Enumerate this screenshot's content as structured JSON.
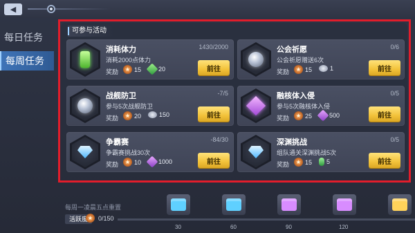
{
  "nav": {
    "tabs": [
      {
        "label": "每日任务",
        "active": false
      },
      {
        "label": "每周任务",
        "active": true
      }
    ]
  },
  "section_title": "可参与活动",
  "reward_label": "奖励",
  "goto_label": "前往",
  "cards": [
    {
      "name": "消耗体力",
      "progress": "1430/2000",
      "desc": "消耗2000点体力",
      "icon": "green-potion-icon",
      "r1_value": "15",
      "r1_icon": "star-coin-icon",
      "r2_value": "20",
      "r2_icon": "green-gem-icon"
    },
    {
      "name": "公会祈愿",
      "progress": "0/6",
      "desc": "公会祈愿赠送6次",
      "icon": "silver-shield-icon",
      "r1_value": "15",
      "r1_icon": "star-coin-icon",
      "r2_value": "1",
      "r2_icon": "silver-gem-icon"
    },
    {
      "name": "战舰防卫",
      "progress": "-7/5",
      "desc": "参与5次战舰防卫",
      "icon": "silver-shield-icon",
      "r1_value": "20",
      "r1_icon": "star-coin-icon",
      "r2_value": "150",
      "r2_icon": "silver-gem-icon"
    },
    {
      "name": "融核体入侵",
      "progress": "0/5",
      "desc": "参与5次融核体入侵",
      "icon": "amethyst-icon",
      "r1_value": "25",
      "r1_icon": "star-coin-icon",
      "r2_value": "500",
      "r2_icon": "purple-gem-icon"
    },
    {
      "name": "争霸赛",
      "progress": "-84/30",
      "desc": "争霸赛挑战30次",
      "icon": "diamond-icon",
      "r1_value": "10",
      "r1_icon": "star-coin-icon",
      "r2_value": "1000",
      "r2_icon": "purple-gem-icon"
    },
    {
      "name": "深渊挑战",
      "progress": "0/5",
      "desc": "组队通关深渊挑战5次",
      "icon": "diamond-icon",
      "r1_value": "15",
      "r1_icon": "star-coin-icon",
      "r2_value": "5",
      "r2_icon": "green-pill-icon"
    }
  ],
  "weekly": {
    "reset_text": "每周一凌晨五点重置",
    "activity_label": "活跃度",
    "activity_value": "0/150",
    "milestones": [
      "30",
      "60",
      "90",
      "120"
    ],
    "chest_colors": [
      "#5fd0ff",
      "#5fd0ff",
      "#d88cff",
      "#d88cff",
      "#ffd25a"
    ]
  },
  "colors": {
    "accent_button": "#f2c23a",
    "highlight_frame": "#e21d2b",
    "active_tab": "#3f74b8"
  }
}
